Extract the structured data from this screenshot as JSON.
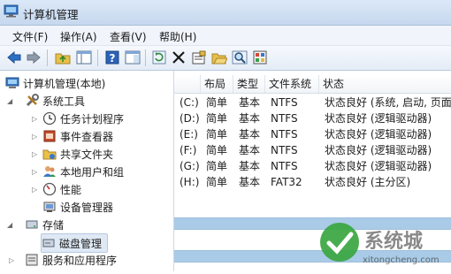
{
  "window": {
    "title": "计算机管理"
  },
  "menu": [
    "文件(F)",
    "操作(A)",
    "查看(V)",
    "帮助(H)"
  ],
  "toolbar": [
    "back-icon",
    "forward-icon",
    "up-folder-icon",
    "console-tree-icon",
    "help-icon",
    "action-pane-icon",
    "refresh-icon",
    "delete-icon",
    "properties-icon",
    "open-icon",
    "search-icon",
    "export-icon"
  ],
  "tree": {
    "root": "计算机管理(本地)",
    "system_tools": "系统工具",
    "items": [
      "任务计划程序",
      "事件查看器",
      "共享文件夹",
      "本地用户和组",
      "性能",
      "设备管理器"
    ],
    "storage": "存储",
    "disk_management": "磁盘管理",
    "services": "服务和应用程序"
  },
  "table": {
    "headers": [
      "",
      "布局",
      "类型",
      "文件系统",
      "状态"
    ],
    "rows": [
      [
        "(C:)",
        "简单",
        "基本",
        "NTFS",
        "状态良好 (系统, 启动, 页面文"
      ],
      [
        "(D:)",
        "简单",
        "基本",
        "NTFS",
        "状态良好 (逻辑驱动器)"
      ],
      [
        "(E:)",
        "简单",
        "基本",
        "NTFS",
        "状态良好 (逻辑驱动器)"
      ],
      [
        "(F:)",
        "简单",
        "基本",
        "NTFS",
        "状态良好 (逻辑驱动器)"
      ],
      [
        "(G:)",
        "简单",
        "基本",
        "NTFS",
        "状态良好 (逻辑驱动器)"
      ],
      [
        "(H:)",
        "简单",
        "基本",
        "FAT32",
        "状态良好 (主分区)"
      ]
    ]
  },
  "watermark": {
    "text": "系统城",
    "url": "xitongcheng.com"
  },
  "colors": {
    "selection": "#dfe9f5",
    "bar": "#a9cbe7",
    "accent": "#2f6fbf"
  }
}
